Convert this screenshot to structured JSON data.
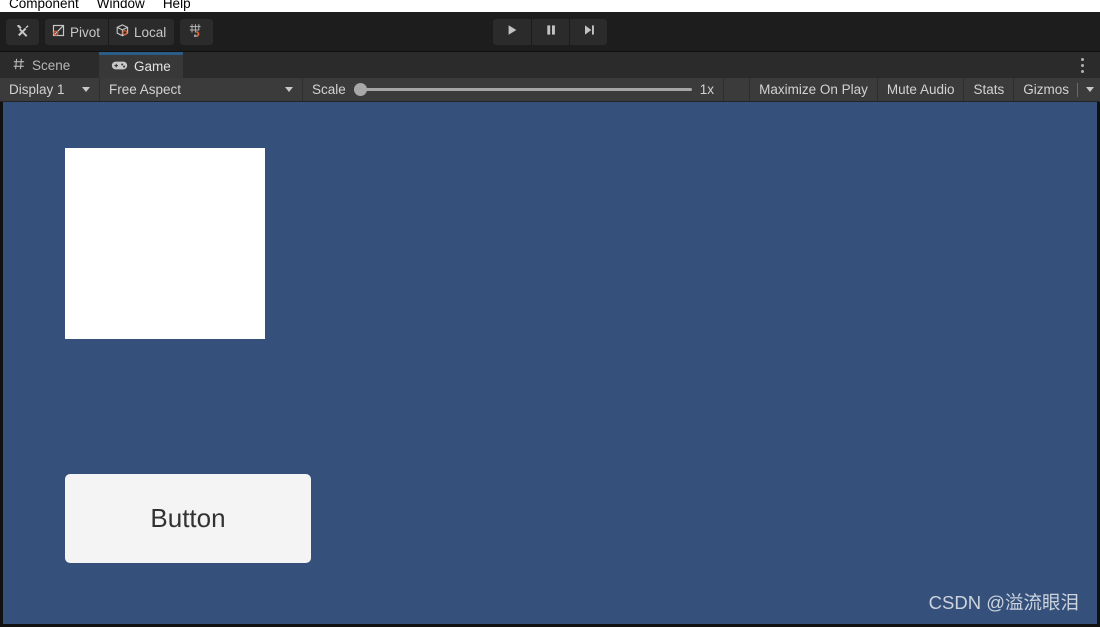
{
  "menu": {
    "items": [
      "Component",
      "Window",
      "Help"
    ]
  },
  "toolbar": {
    "tools_icon": "tools-wrench-screwdriver-icon",
    "pivot_label": "Pivot",
    "pivot_icon": "pivot-square-icon",
    "local_label": "Local",
    "local_icon": "local-cube-icon",
    "grid_snap_icon": "grid-magnet-snap-icon",
    "play_icon": "play-icon",
    "pause_icon": "pause-icon",
    "step_icon": "step-forward-icon",
    "accent_orange": "#d4623a"
  },
  "tabs": [
    {
      "label": "Scene",
      "icon": "scene-grid-icon",
      "active": false
    },
    {
      "label": "Game",
      "icon": "game-gamepad-icon",
      "active": true
    }
  ],
  "tab_menu_icon": "more-vertical-dots-icon",
  "controls": {
    "display": "Display 1",
    "aspect": "Free Aspect",
    "scale_label": "Scale",
    "scale_value": "1x",
    "scale_percent": 0,
    "maximize_on_play": "Maximize On Play",
    "mute_audio": "Mute Audio",
    "stats": "Stats",
    "gizmos": "Gizmos"
  },
  "game": {
    "background_color": "#34507b",
    "white_panel_color": "#ffffff",
    "button_label": "Button",
    "button_color": "#f4f4f4",
    "watermark": "CSDN @溢流眼泪"
  }
}
